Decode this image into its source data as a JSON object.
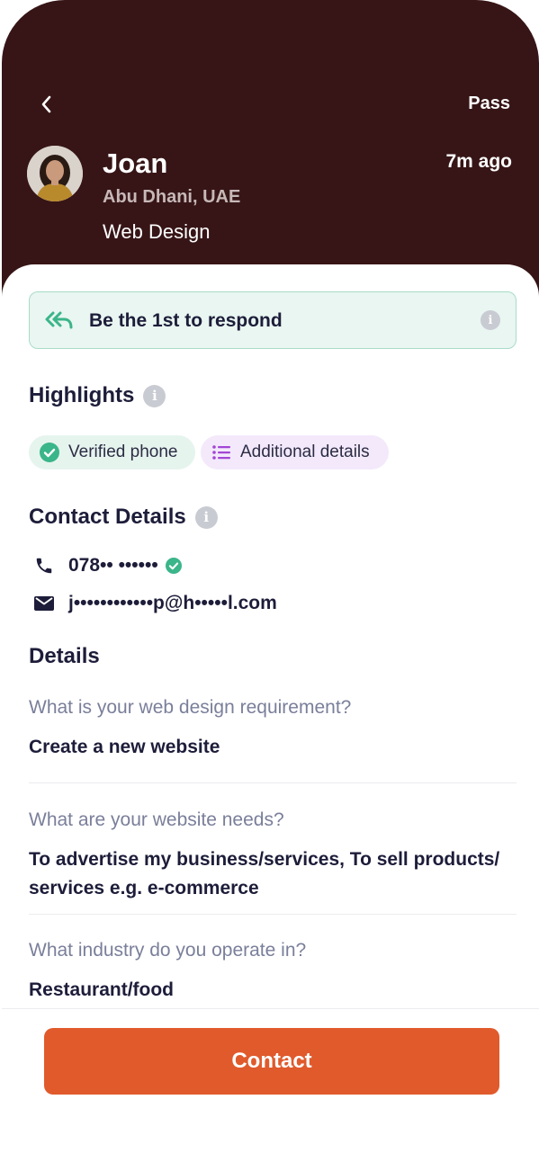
{
  "header": {
    "pass_label": "Pass",
    "name": "Joan",
    "time_ago": "7m ago",
    "location": "Abu Dhani, UAE",
    "category": "Web Design",
    "background_color": "#371516"
  },
  "banner": {
    "label": "Be the 1st to respond",
    "icon": "reply-all-icon",
    "accent_color": "#3bb58a"
  },
  "highlights": {
    "title": "Highlights",
    "chips": [
      {
        "label": "Verified phone",
        "icon": "check-circle-icon",
        "color": "#3bb58a"
      },
      {
        "label": "Additional details",
        "icon": "list-icon",
        "color": "#a346d6"
      }
    ]
  },
  "contact_details": {
    "title": "Contact Details",
    "phone": "078•• ••••••",
    "email": "j••••••••••••p@h•••••l.com"
  },
  "details": {
    "title": "Details",
    "items": [
      {
        "question": "What is your web design requirement?",
        "answer": "Create a new website"
      },
      {
        "question": "What are your website needs?",
        "answer": "To advertise my business/services, To sell products/ services e.g. e-commerce"
      },
      {
        "question": "What industry do you operate in?",
        "answer": "Restaurant/food"
      }
    ]
  },
  "footer": {
    "contact_label": "Contact",
    "button_color": "#e05a2c"
  }
}
